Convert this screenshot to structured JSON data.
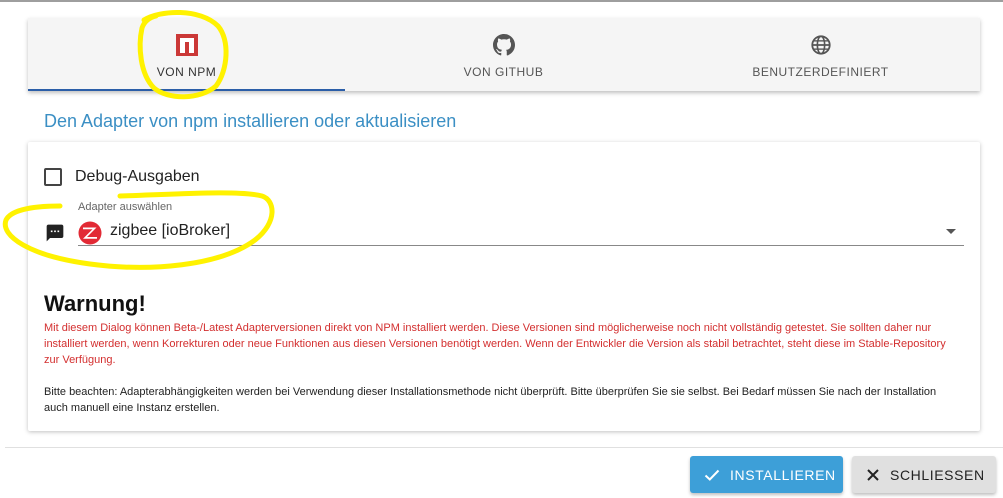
{
  "tabs": [
    {
      "label": "VON NPM",
      "icon": "npm-icon",
      "active": true
    },
    {
      "label": "VON GITHUB",
      "icon": "github-icon",
      "active": false
    },
    {
      "label": "BENUTZERDEFINIERT",
      "icon": "globe-icon",
      "active": false
    }
  ],
  "subtitle": "Den Adapter von npm installieren oder aktualisieren",
  "debug": {
    "label": "Debug-Ausgaben",
    "checked": false
  },
  "adapter_select": {
    "label": "Adapter auswählen",
    "value": "zigbee [ioBroker]"
  },
  "warning": {
    "title": "Warnung!",
    "text": "Mit diesem Dialog können Beta-/Latest Adapterversionen direkt von NPM installiert werden. Diese Versionen sind möglicherweise noch nicht vollständig getestet. Sie sollten daher nur installiert werden, wenn Korrekturen oder neue Funktionen aus diesen Versionen benötigt werden. Wenn der Entwickler die Version als stabil betrachtet, steht diese im Stable-Repository zur Verfügung.",
    "note": "Bitte beachten: Adapterabhängigkeiten werden bei Verwendung dieser Installationsmethode nicht überprüft. Bitte überprüfen Sie sie selbst. Bei Bedarf müssen Sie nach der Installation auch manuell eine Instanz erstellen."
  },
  "buttons": {
    "install": "INSTALLIEREN",
    "close": "SCHLIESSEN"
  },
  "colors": {
    "accent": "#3d9fd8",
    "npm_red": "#cb3837",
    "warning_red": "#d32f2f",
    "highlight": "#fff200"
  }
}
